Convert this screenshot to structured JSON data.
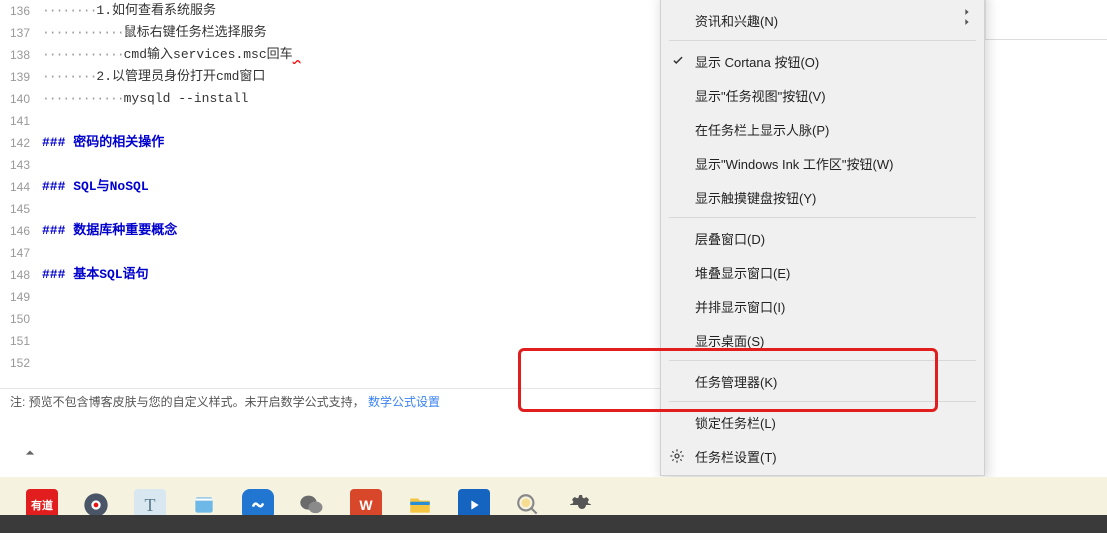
{
  "editor": {
    "lines": [
      {
        "no": "136",
        "prefix": "········",
        "text": "1.如何查看系统服务"
      },
      {
        "no": "137",
        "prefix": "············",
        "text": "鼠标右键任务栏选择服务"
      },
      {
        "no": "138",
        "prefix": "············",
        "text": "cmd输入services.msc回车",
        "err": true
      },
      {
        "no": "139",
        "prefix": "········",
        "text": "2.以管理员身份打开cmd窗口"
      },
      {
        "no": "140",
        "prefix": "············",
        "text": "mysqld --install"
      },
      {
        "no": "141",
        "prefix": "",
        "text": ""
      },
      {
        "no": "142",
        "prefix": "",
        "heading": "### 密码的相关操作"
      },
      {
        "no": "143",
        "prefix": "",
        "text": ""
      },
      {
        "no": "144",
        "prefix": "",
        "heading": "### SQL与NoSQL"
      },
      {
        "no": "145",
        "prefix": "",
        "text": ""
      },
      {
        "no": "146",
        "prefix": "",
        "heading": "### 数据库种重要概念"
      },
      {
        "no": "147",
        "prefix": "",
        "text": ""
      },
      {
        "no": "148",
        "prefix": "",
        "heading": "### 基本SQL语句"
      },
      {
        "no": "149",
        "prefix": "",
        "text": ""
      },
      {
        "no": "150",
        "prefix": "",
        "text": ""
      },
      {
        "no": "151",
        "prefix": "",
        "text": ""
      },
      {
        "no": "152",
        "prefix": "",
        "text": ""
      }
    ]
  },
  "note": {
    "text": "注: 预览不包含博客皮肤与您的自定义样式。未开启数学公式支持，",
    "link": "数学公式设置"
  },
  "menu": {
    "items": [
      {
        "label": "资讯和兴趣(N)",
        "arrow": true
      },
      {
        "sep": true
      },
      {
        "label": "显示 Cortana 按钮(O)",
        "check": true
      },
      {
        "label": "显示\"任务视图\"按钮(V)"
      },
      {
        "label": "在任务栏上显示人脉(P)"
      },
      {
        "label": "显示\"Windows Ink 工作区\"按钮(W)"
      },
      {
        "label": "显示触摸键盘按钮(Y)"
      },
      {
        "sep": true
      },
      {
        "label": "层叠窗口(D)"
      },
      {
        "label": "堆叠显示窗口(E)"
      },
      {
        "label": "并排显示窗口(I)"
      },
      {
        "label": "显示桌面(S)"
      },
      {
        "sep": true
      },
      {
        "label": "任务管理器(K)"
      },
      {
        "sep": true
      },
      {
        "label": "锁定任务栏(L)"
      },
      {
        "label": "任务栏设置(T)",
        "gear": true
      }
    ]
  },
  "taskbar": {
    "youdao": "有道"
  }
}
